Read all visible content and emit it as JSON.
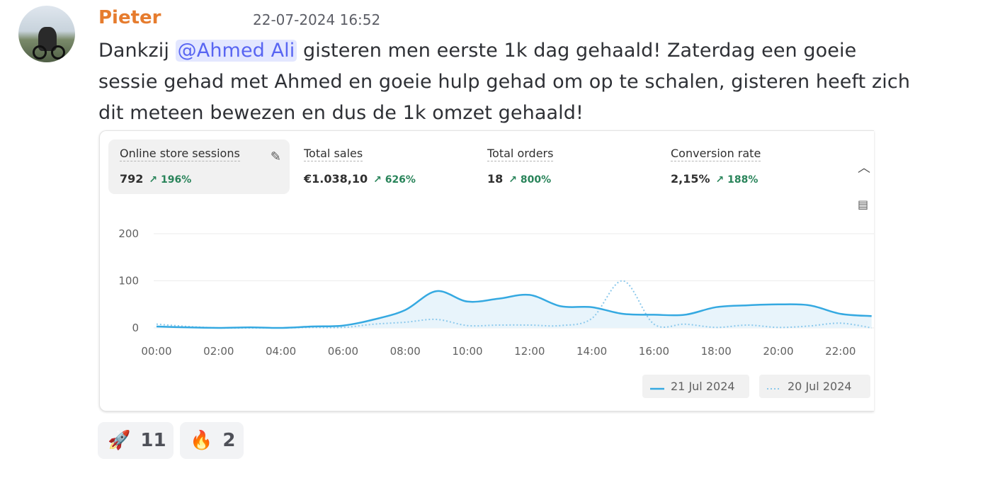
{
  "message": {
    "username": "Pieter",
    "timestamp": "22-07-2024 16:52",
    "text_before_mention": "Dankzij ",
    "mention": "@Ahmed Ali",
    "text_after_mention": " gisteren men eerste 1k dag gehaald! Zaterdag een goeie sessie gehad met Ahmed en goeie hulp gehad om op te schalen, gisteren heeft zich dit meteen bewezen en dus de 1k omzet gehaald!"
  },
  "metrics": [
    {
      "label": "Online store sessions",
      "value": "792",
      "change": "↗ 196%"
    },
    {
      "label": "Total sales",
      "value": "€1.038,10",
      "change": "↗ 626%"
    },
    {
      "label": "Total orders",
      "value": "18",
      "change": "↗ 800%"
    },
    {
      "label": "Conversion rate",
      "value": "2,15%",
      "change": "↗ 188%"
    }
  ],
  "icons": {
    "edit": "pencil-icon",
    "collapse": "chevron-up-icon",
    "chat": "chat-search-icon"
  },
  "chart_data": {
    "type": "line",
    "ylim": [
      0,
      200
    ],
    "yticks": [
      "0",
      "100",
      "200"
    ],
    "xticks": [
      "00:00",
      "02:00",
      "04:00",
      "06:00",
      "08:00",
      "10:00",
      "12:00",
      "14:00",
      "16:00",
      "18:00",
      "20:00",
      "22:00"
    ],
    "x_hours": [
      0,
      1,
      2,
      3,
      4,
      5,
      6,
      7,
      8,
      9,
      10,
      11,
      12,
      13,
      14,
      15,
      16,
      17,
      18,
      19,
      20,
      21,
      22,
      23
    ],
    "series": [
      {
        "name": "21 Jul 2024",
        "color": "#35a9e1",
        "style": "solid",
        "values": [
          3,
          1,
          0,
          1,
          0,
          3,
          5,
          18,
          38,
          78,
          56,
          62,
          70,
          46,
          44,
          30,
          28,
          28,
          44,
          48,
          50,
          48,
          30,
          25
        ]
      },
      {
        "name": "20 Jul 2024",
        "color": "#8cc9ec",
        "style": "dotted",
        "values": [
          8,
          3,
          0,
          0,
          0,
          1,
          1,
          8,
          12,
          18,
          5,
          6,
          6,
          5,
          20,
          100,
          8,
          8,
          1,
          6,
          1,
          4,
          10,
          0
        ]
      }
    ],
    "legend_position": "bottom-right"
  },
  "reactions": [
    {
      "emoji": "🚀",
      "count": "11"
    },
    {
      "emoji": "🔥",
      "count": "2"
    }
  ]
}
